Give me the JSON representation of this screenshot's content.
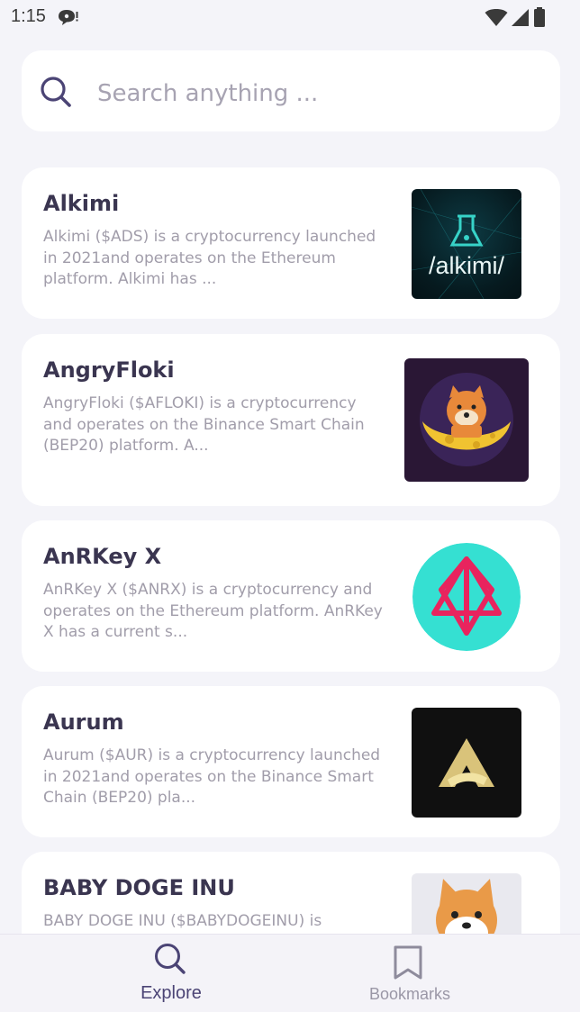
{
  "status_bar": {
    "time": "1:15"
  },
  "search": {
    "placeholder": "Search anything ..."
  },
  "cards": [
    {
      "title": "Alkimi",
      "description": "Alkimi ($ADS) is a cryptocurrency launched in 2021and operates on the Ethereum platform. Alkimi has ...",
      "logo_text": "/alkimi/"
    },
    {
      "title": "AngryFloki",
      "description": "AngryFloki ($AFLOKI) is a cryptocurrency and operates on the Binance Smart Chain (BEP20) platform. A..."
    },
    {
      "title": "AnRKey X",
      "description": "AnRKey X ($ANRX) is a cryptocurrency and operates on the Ethereum platform. AnRKey X has a current s..."
    },
    {
      "title": "Aurum",
      "description": "Aurum ($AUR) is a cryptocurrency launched in 2021and operates on the Binance Smart Chain (BEP20) pla..."
    },
    {
      "title": "BABY DOGE INU",
      "description": "BABY DOGE INU ($BABYDOGEINU) is"
    }
  ],
  "bottom_nav": {
    "items": [
      {
        "label": "Explore",
        "icon": "search-icon",
        "active": true
      },
      {
        "label": "Bookmarks",
        "icon": "bookmark-icon",
        "active": false
      }
    ]
  },
  "colors": {
    "background": "#f4f4f9",
    "card": "#ffffff",
    "title": "#3a3550",
    "muted": "#a19daa",
    "accent": "#4b4475"
  }
}
